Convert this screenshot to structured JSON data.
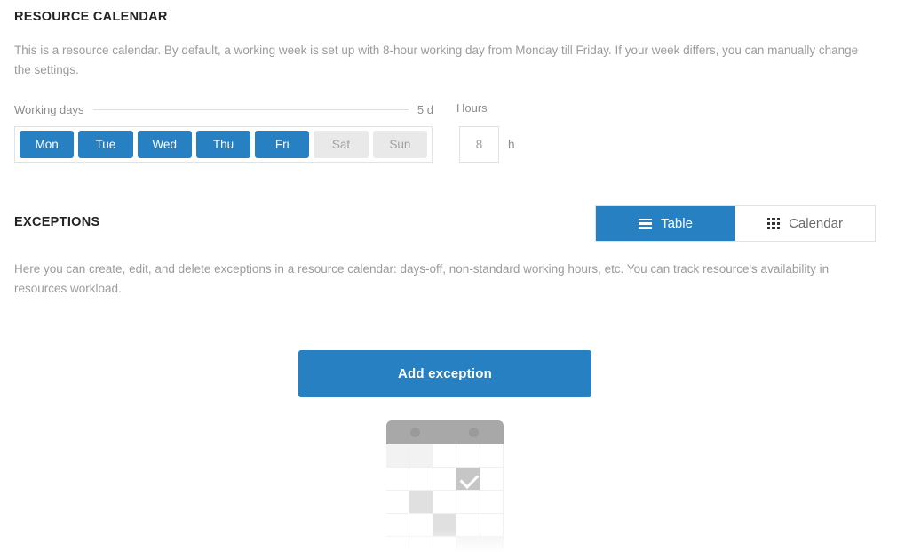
{
  "resource_calendar": {
    "title": "RESOURCE CALENDAR",
    "description": "This is a resource calendar. By default, a working week is set up with 8-hour working day from Monday till Friday. If your week differs, you can manually change the settings.",
    "working_days": {
      "label": "Working days",
      "value": "5 d",
      "days": [
        {
          "label": "Mon",
          "selected": true
        },
        {
          "label": "Tue",
          "selected": true
        },
        {
          "label": "Wed",
          "selected": true
        },
        {
          "label": "Thu",
          "selected": true
        },
        {
          "label": "Fri",
          "selected": true
        },
        {
          "label": "Sat",
          "selected": false
        },
        {
          "label": "Sun",
          "selected": false
        }
      ]
    },
    "hours": {
      "label": "Hours",
      "value": "8",
      "placeholder": "8",
      "unit": "h"
    }
  },
  "exceptions": {
    "title": "EXCEPTIONS",
    "description": "Here you can create, edit, and delete exceptions in a resource calendar: days-off, non-standard working hours, etc. You can track resource's availability in resources workload.",
    "view_toggle": {
      "table": {
        "label": "Table",
        "icon": "list-icon",
        "active": true
      },
      "calendar": {
        "label": "Calendar",
        "icon": "grid-icon",
        "active": false
      }
    },
    "add_button": "Add exception",
    "empty_illustration": "calendar-empty-state-icon"
  },
  "colors": {
    "accent": "#2680c2",
    "inactive_day": "#e9e9e9",
    "text_muted": "#9b9b9b",
    "border": "#e2e2e2"
  }
}
